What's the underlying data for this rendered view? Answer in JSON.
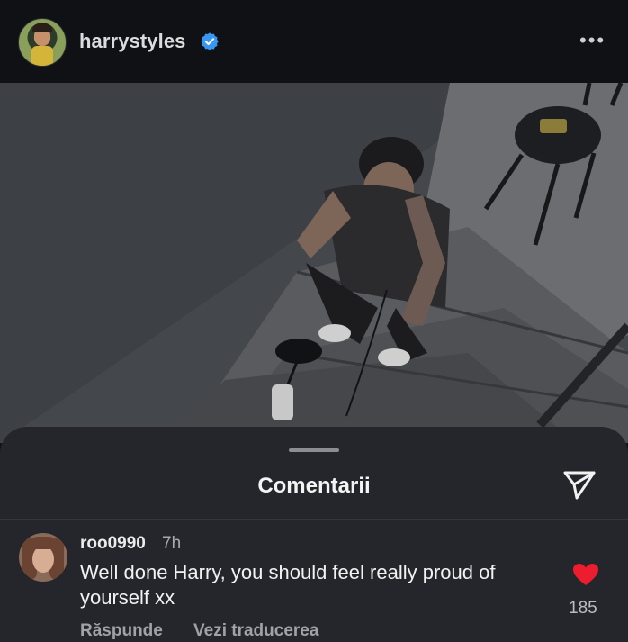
{
  "post": {
    "username": "harrystyles",
    "more_label": "•••",
    "photo_alt": "harrystyles post"
  },
  "comments_sheet": {
    "title": "Comentarii"
  },
  "comment": {
    "username": "roo0990",
    "time": "7h",
    "text": "Well done Harry, you should feel really proud of yourself xx",
    "likes": "185",
    "reply_label": "Răspunde",
    "translate_label": "Vezi traducerea"
  },
  "colors": {
    "verified": "#3897f0",
    "heart": "#ed1c2e",
    "sheet_bg": "#24262b"
  },
  "icons": {
    "verified": "verified-badge-icon",
    "more": "more-options-icon",
    "share": "share-icon",
    "like": "heart-icon"
  }
}
